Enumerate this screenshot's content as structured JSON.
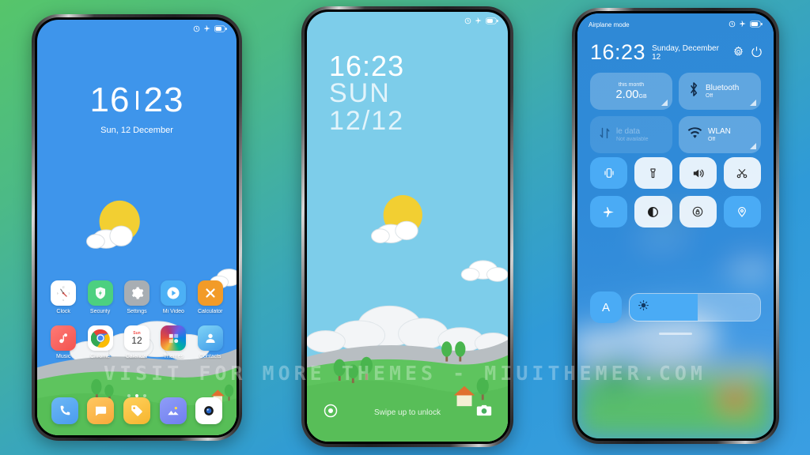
{
  "watermark": {
    "text": "VISIT FOR MORE THEMES - MIUITHEMER.COM"
  },
  "colors": {
    "bg_green": "#56c56a",
    "bg_blue": "#3a9ee2",
    "accent_blue": "#4aabf5",
    "sky_home": "#3e95eb",
    "sky_lock": "#7dcdea",
    "grass": "#5ec45e",
    "sun": "#f2cf32"
  },
  "phone1": {
    "name": "Home screen",
    "status": {
      "alarm": "alarm-icon",
      "airplane": "airplane-icon",
      "battery": "battery-icon"
    },
    "clock": {
      "hours": "16",
      "minutes": "23",
      "date": "Sun, 12 December"
    },
    "apps_row1": [
      {
        "label": "Clock",
        "icon": "clock-icon"
      },
      {
        "label": "Security",
        "icon": "shield-icon"
      },
      {
        "label": "Settings",
        "icon": "gear-icon"
      },
      {
        "label": "Mi Video",
        "icon": "play-icon"
      },
      {
        "label": "Calculator",
        "icon": "close-x-icon"
      }
    ],
    "apps_row2": [
      {
        "label": "Music",
        "icon": "music-note-icon"
      },
      {
        "label": "Chrome",
        "icon": "chrome-icon"
      },
      {
        "label": "Calendar",
        "icon": "calendar-icon",
        "day_name": "Sun",
        "day_num": "12"
      },
      {
        "label": "Themes",
        "icon": "themes-icon"
      },
      {
        "label": "Contacts",
        "icon": "contacts-icon"
      }
    ],
    "dock": [
      {
        "label": "Phone",
        "icon": "phone-icon"
      },
      {
        "label": "Messages",
        "icon": "message-icon"
      },
      {
        "label": "Notes",
        "icon": "tag-icon"
      },
      {
        "label": "Gallery",
        "icon": "gallery-icon"
      },
      {
        "label": "Camera",
        "icon": "camera-icon"
      }
    ],
    "page_indicator": {
      "count": 3,
      "active": 1
    }
  },
  "phone2": {
    "name": "Lock screen",
    "status": {
      "alarm": "alarm-icon",
      "airplane": "airplane-icon",
      "battery": "battery-icon"
    },
    "clock": {
      "time": "16:23",
      "weekday": "SUN",
      "date": "12/12"
    },
    "bottom": {
      "flashlight_icon": "flashlight-circle-icon",
      "hint": "Swipe up to unlock",
      "camera_icon": "camera-icon"
    }
  },
  "phone3": {
    "name": "Control center",
    "status": {
      "label": "Airplane mode",
      "alarm": "alarm-icon",
      "airplane": "airplane-icon",
      "battery": "battery-icon"
    },
    "clock": {
      "time": "16:23",
      "date": "Sunday, December 12"
    },
    "header_icons": [
      {
        "name": "settings-gear-icon"
      },
      {
        "name": "power-icon"
      }
    ],
    "big_tiles": [
      {
        "title": "this month",
        "value": "2.00",
        "unit": "GB",
        "kind": "data-usage",
        "enabled": true
      },
      {
        "title": "Bluetooth",
        "sub": "Off",
        "icon": "bluetooth-icon",
        "enabled": true
      },
      {
        "title": "le data",
        "sub": "Not available",
        "icon": "mobile-data-icon",
        "enabled": false
      },
      {
        "title": "WLAN",
        "sub": "Off",
        "icon": "wifi-icon",
        "enabled": true
      }
    ],
    "toggles_row1": [
      {
        "name": "vibrate-icon",
        "on": true
      },
      {
        "name": "flashlight-icon",
        "on": false
      },
      {
        "name": "sound-icon",
        "on": false
      },
      {
        "name": "screenshot-scissors-icon",
        "on": false
      }
    ],
    "toggles_row2": [
      {
        "name": "airplane-icon",
        "on": true
      },
      {
        "name": "dark-mode-icon",
        "on": false
      },
      {
        "name": "rotation-lock-icon",
        "on": false
      },
      {
        "name": "location-icon",
        "on": true
      }
    ],
    "brightness": {
      "auto_label": "A",
      "auto_on": true,
      "slider_icon": "brightness-sun-icon",
      "percent": 52
    }
  }
}
